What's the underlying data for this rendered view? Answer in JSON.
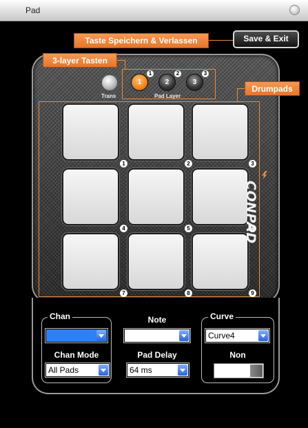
{
  "window": {
    "title": "Pad"
  },
  "toolbar": {
    "save_exit_label": "Save & Exit"
  },
  "callouts": {
    "save": "Taste Speichern & Verlassen",
    "layer": "3-layer Tasten",
    "drumpads": "Drumpads"
  },
  "device": {
    "trans_label": "Trans",
    "pad_layer_label": "Pad Layer",
    "layer_buttons": [
      "1",
      "2",
      "3"
    ],
    "active_layer": "1",
    "brand": "CONPAD",
    "pads": [
      "1",
      "2",
      "3",
      "4",
      "5",
      "6",
      "7",
      "8",
      "9"
    ]
  },
  "controls": {
    "chan_label": "Chan",
    "chan_value": "",
    "note_label": "Note",
    "note_value": "",
    "curve_label": "Curve",
    "curve_value": "Curve4",
    "chan_mode_label": "Chan Mode",
    "chan_mode_value": "All Pads",
    "pad_delay_label": "Pad Delay",
    "pad_delay_value": "64 ms",
    "non_label": "Non"
  },
  "colors": {
    "accent_orange": "#e98b3c",
    "select_blue": "#2f7ff5",
    "background": "#000000"
  }
}
